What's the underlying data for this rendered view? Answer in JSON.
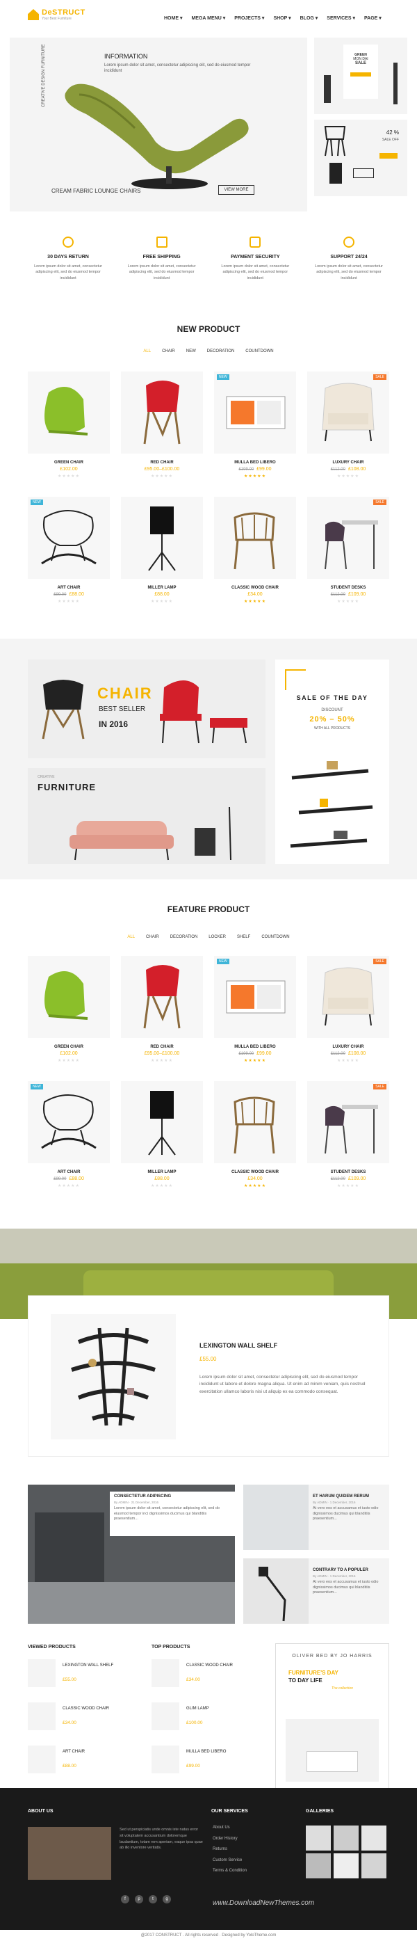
{
  "header": {
    "logo_text": "DeSTRUCT",
    "logo_sub": "Your Best Furniture",
    "nav": [
      "HOME ▾",
      "MEGA MENU ▾",
      "PROJECTS ▾",
      "SHOP ▾",
      "BLOG ▾",
      "SERVICES ▾",
      "PAGE ▾"
    ]
  },
  "slider": {
    "tag": "INFORMATION",
    "text": "Lorem ipsum dolor sit amet, consectetur adipiscing elit, sed do eiusmod tempor incididunt",
    "vertical": "CREATIVE DESIGN FURNITURE",
    "caption": "CREAM FABRIC LOUNGE CHAIRS",
    "button": "VIEW MORE",
    "side1": {
      "line1": "GREEN",
      "line2": "MON DAI",
      "line3": "SALE"
    },
    "side2": {
      "percent": "42 %",
      "label": "SALE OFF"
    }
  },
  "features": [
    {
      "title": "30 DAYS RETURN",
      "desc": "Lorem ipsum dolor sit amet, consectetur adipiscing elit, sed do eiusmod tempor incididunt",
      "icon": "refresh-icon"
    },
    {
      "title": "FREE SHIPPING",
      "desc": "Lorem ipsum dolor sit amet, consectetur adipiscing elit, sed do eiusmod tempor incididunt",
      "icon": "truck-icon"
    },
    {
      "title": "PAYMENT SECURITY",
      "desc": "Lorem ipsum dolor sit amet, consectetur adipiscing elit, sed do eiusmod tempor incididunt",
      "icon": "lock-icon"
    },
    {
      "title": "SUPPORT 24/24",
      "desc": "Lorem ipsum dolor sit amet, consectetur adipiscing elit, sed do eiusmod tempor incididunt",
      "icon": "headset-icon"
    }
  ],
  "new_product": {
    "title": "NEW PRODUCT",
    "tabs": [
      "ALL",
      "CHAIR",
      "NEW",
      "DECORATION",
      "COUNTDOWN"
    ]
  },
  "feature_product": {
    "title": "FEATURE PRODUCT",
    "tabs": [
      "ALL",
      "CHAIR",
      "DECORATION",
      "LOCKER",
      "SHELF",
      "COUNTDOWN"
    ]
  },
  "products": [
    {
      "name": "GREEN CHAIR",
      "old": "",
      "price": "£102.00",
      "badge": "",
      "rating": 0
    },
    {
      "name": "RED CHAIR",
      "old": "",
      "price": "£95.00–£100.00",
      "badge": "",
      "rating": 0
    },
    {
      "name": "MULLA BED LIBERO",
      "old": "£199.00",
      "price": "£99.00",
      "badge": "NEW",
      "rating": 5
    },
    {
      "name": "LUXURY CHAIR",
      "old": "£112.00",
      "price": "£108.00",
      "badge": "SALE",
      "rating": 0
    },
    {
      "name": "ART CHAIR",
      "old": "£99.00",
      "price": "£88.00",
      "badge": "NEW",
      "rating": 0
    },
    {
      "name": "MILLER LAMP",
      "old": "",
      "price": "£88.00",
      "badge": "",
      "rating": 0
    },
    {
      "name": "CLASSIC WOOD CHAIR",
      "old": "",
      "price": "£34.00",
      "badge": "",
      "rating": 5
    },
    {
      "name": "STUDENT DESKS",
      "old": "£112.00",
      "price": "£109.00",
      "badge": "SALE",
      "rating": 0
    }
  ],
  "banners": {
    "chair_title": "CHAIR",
    "chair_sub": "BEST SELLER",
    "chair_year": "IN 2016",
    "furniture_sub": "CREATIVE",
    "furniture_title": "FURNITURE",
    "sod_title": "SALE OF THE DAY",
    "sod_discount": "DISCOUNT",
    "sod_percent": "20% – 50%",
    "sod_all": "WITH ALL PRODUCTS"
  },
  "promo": {
    "title": "LEXINGTON WALL SHELF",
    "price": "£55.00",
    "desc": "Lorem ipsum dolor sit amet, consectetur adipiscing elit, sed do eiusmod tempor incididunt ut labore et dolore magna aliqua. Ut enim ad minim veniam, quis nostrud exercitation ullamco laboris nisi ut aliquip ex ea commodo consequat."
  },
  "blog": [
    {
      "title": "CONSECTETUR ADIPISCING",
      "meta": "By ADMIN · 21 December, 2016",
      "desc": "Lorem ipsum dolor sit amet, consectetur adipiscing elit, sed do eiusmod tempor inci dignissimos ducimus qui blanditiis praesentium..."
    },
    {
      "title": "ET HARUM QUIDEM RERUM",
      "meta": "By ADMIN · 1 December, 2016",
      "desc": "At vero eos et accusamus et iusto odio dignissimos ducimus qui blanditiis praesentium..."
    },
    {
      "title": "CONTRARY TO A POPULER",
      "meta": "By ADMIN · 1 December, 2016",
      "desc": "At vero eos et accusamus et iusto odio dignissimos ducimus qui blanditiis praesentium..."
    }
  ],
  "viewed": {
    "title": "VIEWED PRODUCTS",
    "items": [
      {
        "name": "LEXINGTON WALL SHELF",
        "price": "£55.00"
      },
      {
        "name": "CLASSIC WOOD CHAIR",
        "price": "£34.00"
      },
      {
        "name": "ART CHAIR",
        "price": "£88.00"
      }
    ]
  },
  "top": {
    "title": "TOP PRODUCTS",
    "items": [
      {
        "name": "CLASSIC WOOD CHAIR",
        "price": "£34.00"
      },
      {
        "name": "GLIM LAMP",
        "price": "£100.00"
      },
      {
        "name": "MULLA BED LIBERO",
        "price": "£99.00"
      }
    ]
  },
  "oliver": {
    "title": "OLIVER BED BY JO HARRIS",
    "sub1": "FURNITURE'S DAY",
    "sub2": "TO DAY LIFE",
    "note": "The collection"
  },
  "footer": {
    "about_title": "ABOUT US",
    "about_text": "Sed ut perspiciatis unde omnis iste natus error sit voluptatem accusantium doloremque laudantium, totam rem aperiam, eaque ipsa quae ab illo inventore veritatis.",
    "services_title": "OUR SERVICES",
    "services": [
      "About Us",
      "Order History",
      "Returns",
      "Custom Service",
      "Terms & Condition"
    ],
    "galleries_title": "GALLERIES",
    "watermark": "www.DownloadNewThemes.com"
  },
  "copyright": "@2017 CONSTRUCT . All rights reserved · Designed by YoloTheme.com"
}
